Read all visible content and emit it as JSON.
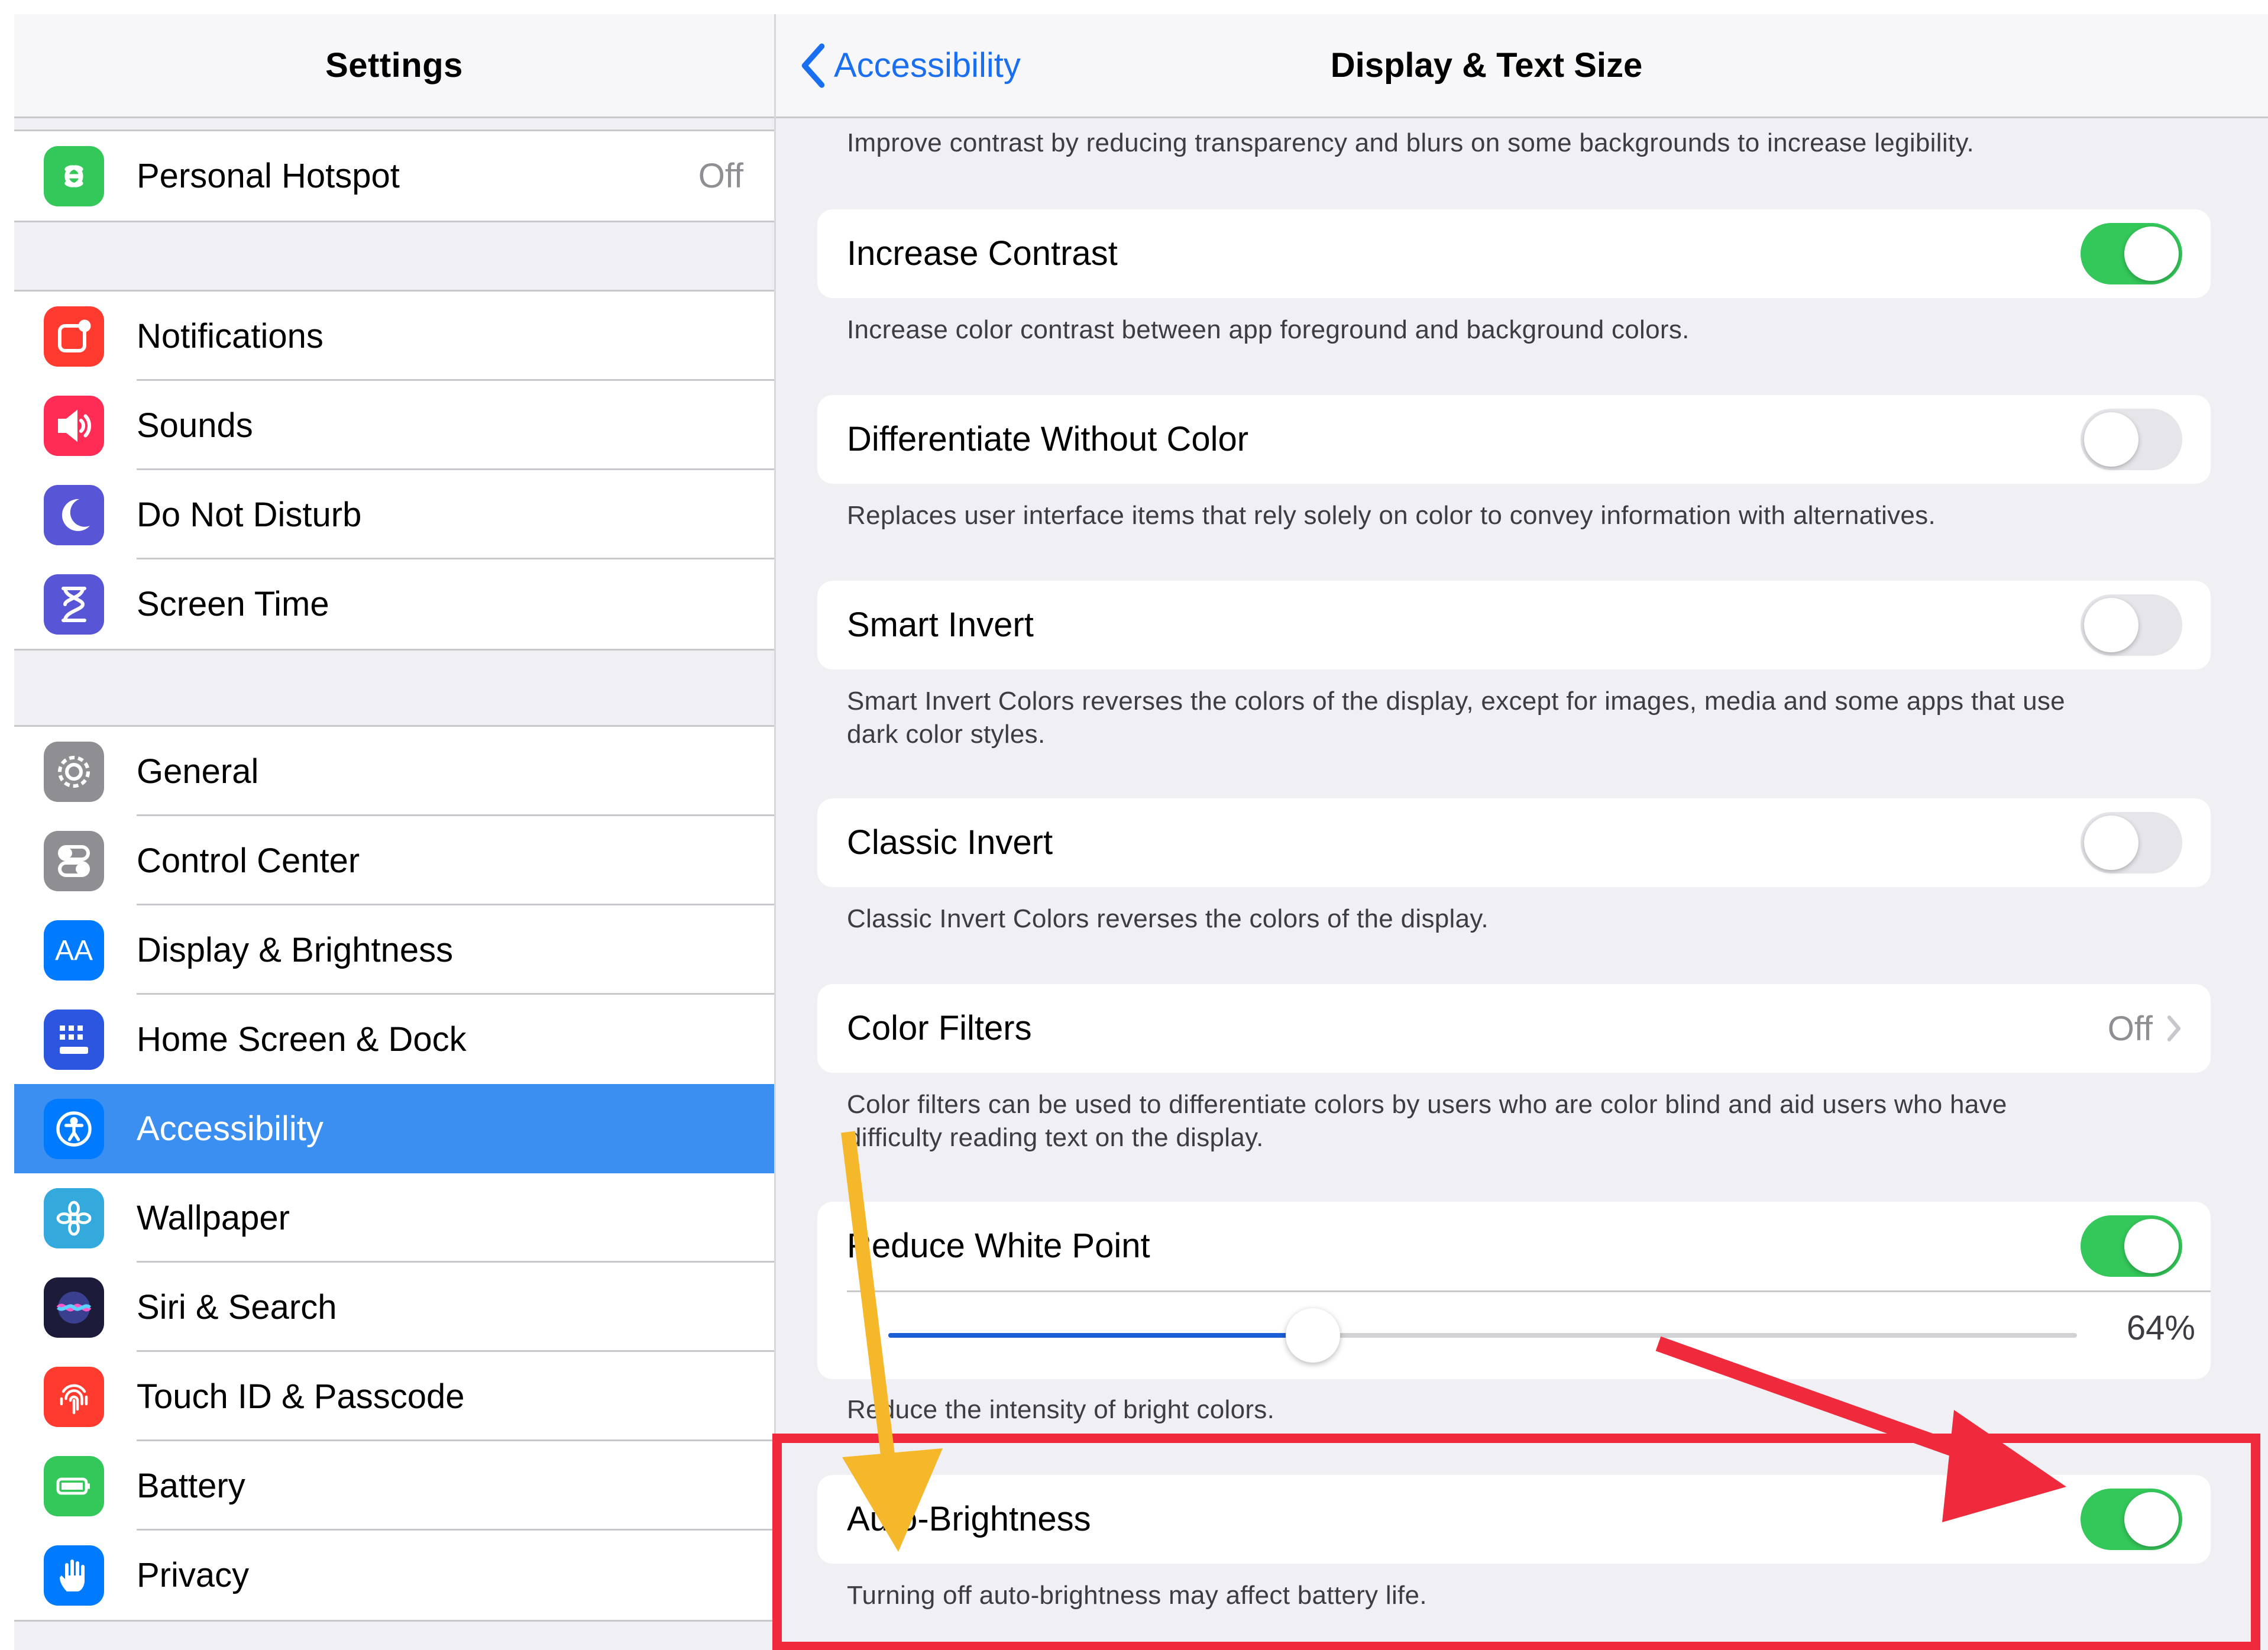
{
  "sidebar": {
    "title": "Settings",
    "groups": [
      {
        "items": [
          {
            "label": "Personal Hotspot",
            "value": "Off",
            "icon": "personal-hotspot-icon",
            "color": "#34c759"
          }
        ]
      },
      {
        "items": [
          {
            "label": "Notifications",
            "icon": "notifications-icon",
            "color": "#ff3b30"
          },
          {
            "label": "Sounds",
            "icon": "sounds-icon",
            "color": "#ff2d55"
          },
          {
            "label": "Do Not Disturb",
            "icon": "moon-icon",
            "color": "#5856d6"
          },
          {
            "label": "Screen Time",
            "icon": "hourglass-icon",
            "color": "#5856d6"
          }
        ]
      },
      {
        "items": [
          {
            "label": "General",
            "icon": "gear-icon",
            "color": "#8e8e93"
          },
          {
            "label": "Control Center",
            "icon": "switches-icon",
            "color": "#8e8e93"
          },
          {
            "label": "Display & Brightness",
            "icon": "text-size-icon",
            "color": "#007aff"
          },
          {
            "label": "Home Screen & Dock",
            "icon": "home-grid-icon",
            "color": "#2d56e0"
          },
          {
            "label": "Accessibility",
            "icon": "accessibility-icon",
            "color": "#007aff",
            "selected": true
          },
          {
            "label": "Wallpaper",
            "icon": "flower-icon",
            "color": "#34aadc"
          },
          {
            "label": "Siri & Search",
            "icon": "siri-icon",
            "color": "#1c1c3a"
          },
          {
            "label": "Touch ID & Passcode",
            "icon": "fingerprint-icon",
            "color": "#ff3b30"
          },
          {
            "label": "Battery",
            "icon": "battery-icon",
            "color": "#34c759"
          },
          {
            "label": "Privacy",
            "icon": "hand-icon",
            "color": "#007aff"
          }
        ]
      }
    ]
  },
  "detail": {
    "back_label": "Accessibility",
    "title": "Display & Text Size",
    "top_note": "Improve contrast by reducing transparency and blurs on some backgrounds to increase legibility.",
    "settings": {
      "increase_contrast": {
        "label": "Increase Contrast",
        "on": true,
        "note": "Increase color contrast between app foreground and background colors."
      },
      "differentiate": {
        "label": "Differentiate Without Color",
        "on": false,
        "note": "Replaces user interface items that rely solely on color to convey information with alternatives."
      },
      "smart_invert": {
        "label": "Smart Invert",
        "on": false,
        "note_line1": "Smart Invert Colors reverses the colors of the display, except for images, media and some apps that use",
        "note_line2": "dark color styles."
      },
      "classic_invert": {
        "label": "Classic Invert",
        "on": false,
        "note": "Classic Invert Colors reverses the colors of the display."
      },
      "color_filters": {
        "label": "Color Filters",
        "value": "Off",
        "note_line1": "Color filters can be used to differentiate colors by users who are color blind and aid users who have",
        "note_line2": "difficulty reading text on the display."
      },
      "reduce_white_point": {
        "label": "Reduce White Point",
        "on": true,
        "slider_percent": 64,
        "slider_value_text": "64%",
        "note": "Reduce the intensity of bright colors."
      },
      "auto_brightness": {
        "label": "Auto-Brightness",
        "on": true,
        "note": "Turning off auto-brightness may affect battery life."
      }
    }
  },
  "colors": {
    "toggle_on": "#34c759",
    "link": "#1a6ff0",
    "selection": "#3b8ff0",
    "annotation_red": "#ee2a3c",
    "annotation_yellow": "#f4b82a"
  }
}
